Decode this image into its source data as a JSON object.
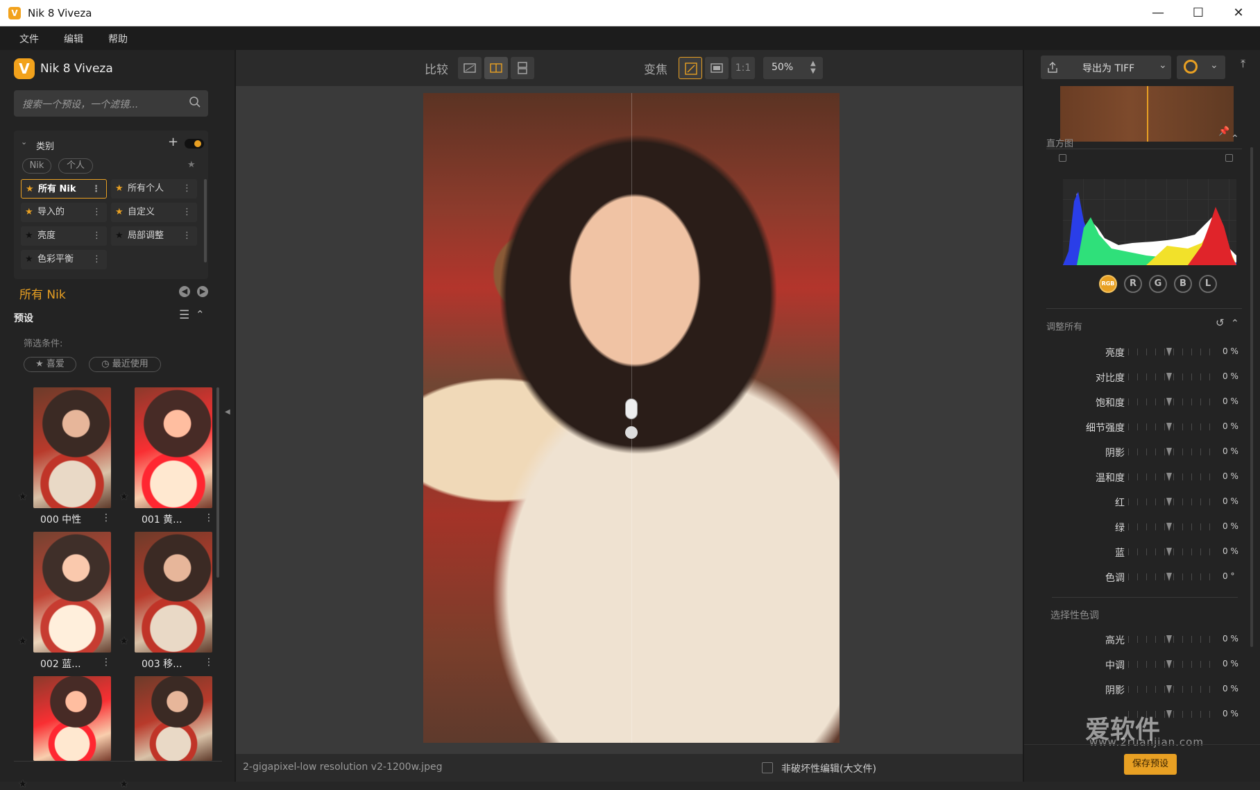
{
  "window": {
    "title": "Nik 8 Viveza"
  },
  "menu": [
    "文件",
    "编辑",
    "帮助"
  ],
  "left": {
    "app_name": "Nik 8 Viveza",
    "search_placeholder": "搜索一个预设，一个滤镜...",
    "category_label": "类别",
    "pills": [
      "Nik",
      "个人"
    ],
    "categories": [
      {
        "label": "所有 Nik",
        "selected": true,
        "star": "orange"
      },
      {
        "label": "所有个人",
        "selected": false,
        "star": "orange"
      },
      {
        "label": "导入的",
        "selected": false,
        "star": "orange"
      },
      {
        "label": "自定义",
        "selected": false,
        "star": "orange"
      },
      {
        "label": "亮度",
        "selected": false,
        "star": "dark"
      },
      {
        "label": "局部调整",
        "selected": false,
        "star": "dark"
      },
      {
        "label": "色彩平衡",
        "selected": false,
        "star": "dark"
      }
    ],
    "collection_title": "所有 Nik",
    "presets_label": "预设",
    "filter_label": "筛选条件:",
    "filters": [
      "喜爱",
      "最近使用"
    ],
    "thumbnails": [
      {
        "label": "000 中性"
      },
      {
        "label": "001 黄..."
      },
      {
        "label": "002 蓝..."
      },
      {
        "label": "003 移..."
      },
      {
        "label": ""
      },
      {
        "label": ""
      }
    ]
  },
  "toolbar": {
    "compare_label": "比较",
    "zoom_label": "变焦",
    "one_to_one": "1:1",
    "zoom_value": "50%"
  },
  "status": {
    "filename": "2-gigapixel-low resolution v2-1200w.jpeg",
    "nondestructive_label": "非破坏性编辑(大文件)"
  },
  "right": {
    "export_label": "导出为 TIFF",
    "histogram_label": "直方图",
    "channels": [
      "RGB",
      "R",
      "G",
      "B",
      "L"
    ],
    "adjust_label": "调整所有",
    "sliders": [
      {
        "label": "亮度",
        "value": "0 %"
      },
      {
        "label": "对比度",
        "value": "0 %"
      },
      {
        "label": "饱和度",
        "value": "0 %"
      },
      {
        "label": "细节强度",
        "value": "0 %"
      },
      {
        "label": "阴影",
        "value": "0 %"
      },
      {
        "label": "温和度",
        "value": "0 %"
      },
      {
        "label": "红",
        "value": "0 %"
      },
      {
        "label": "绿",
        "value": "0 %"
      },
      {
        "label": "蓝",
        "value": "0 %"
      },
      {
        "label": "色调",
        "value": "0 °"
      }
    ],
    "selective_label": "选择性色调",
    "selective_sliders": [
      {
        "label": "高光",
        "value": "0 %"
      },
      {
        "label": "中调",
        "value": "0 %"
      },
      {
        "label": "阴影",
        "value": "0 %"
      },
      {
        "label": "",
        "value": "0 %"
      }
    ],
    "save_preset_label": "保存预设",
    "watermark": "爱软件",
    "watermark_url": "www.2ruanjian.com"
  },
  "colors": {
    "accent": "#e8a023",
    "panel": "#232323",
    "canvas": "#3a3a3a"
  }
}
